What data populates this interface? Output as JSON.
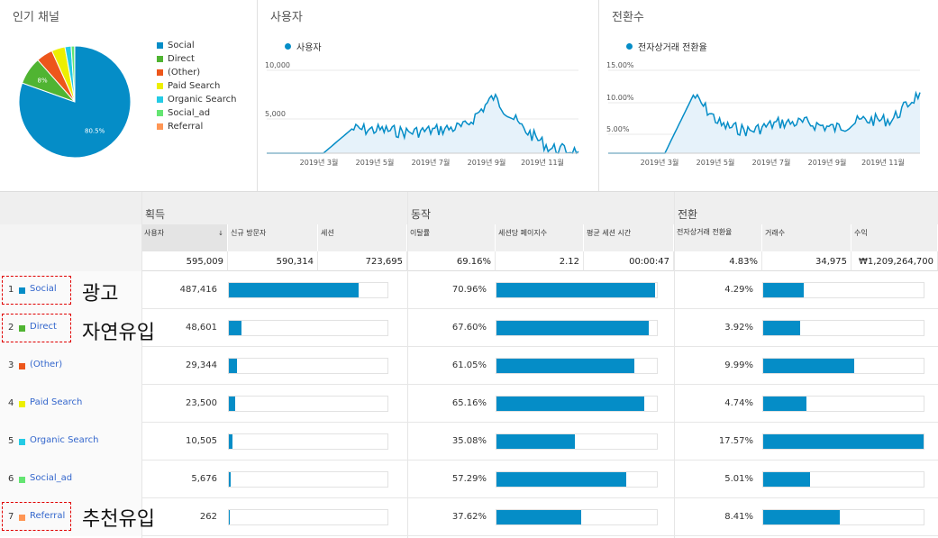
{
  "pie_panel": {
    "title": "인기 채널",
    "slices": [
      {
        "name": "Social",
        "value": 80.5,
        "color": "#058dc7",
        "label": "80.5%"
      },
      {
        "name": "Direct",
        "value": 8.0,
        "color": "#50b432",
        "label": "8%"
      },
      {
        "name": "(Other)",
        "value": 4.8,
        "color": "#ed561b",
        "label": ""
      },
      {
        "name": "Paid Search",
        "value": 3.9,
        "color": "#edef00",
        "label": ""
      },
      {
        "name": "Organic Search",
        "value": 1.8,
        "color": "#24cbe5",
        "label": ""
      },
      {
        "name": "Social_ad",
        "value": 1.0,
        "color": "#64e572",
        "label": ""
      },
      {
        "name": "Referral",
        "value": 0.04,
        "color": "#ff9655",
        "label": ""
      }
    ]
  },
  "chart_data": [
    {
      "type": "area",
      "title": "사용자",
      "series": [
        {
          "name": "사용자",
          "color": "#058dc7"
        }
      ],
      "yticks": [
        "10,000",
        "5,000"
      ],
      "ylim": [
        0,
        11000
      ],
      "xticks": [
        "2019년 3월",
        "2019년 5월",
        "2019년 7월",
        "2019년 9월",
        "2019년 11월"
      ],
      "x": [
        "2019-01",
        "2019-02",
        "2019-03",
        "2019-04",
        "2019-05",
        "2019-06",
        "2019-07",
        "2019-08",
        "2019-09",
        "2019-10",
        "2019-11",
        "2019-12"
      ],
      "values": [
        0,
        0,
        0,
        3000,
        2900,
        2600,
        2900,
        3300,
        7000,
        3200,
        600,
        200
      ]
    },
    {
      "type": "area",
      "title": "전환수",
      "series": [
        {
          "name": "전자상거래 전환율",
          "color": "#058dc7"
        }
      ],
      "yticks": [
        "15.00%",
        "10.00%",
        "5.00%"
      ],
      "ylim": [
        0,
        16
      ],
      "xticks": [
        "2019년 3월",
        "2019년 5월",
        "2019년 7월",
        "2019년 9월",
        "2019년 11월"
      ],
      "x": [
        "2019-01",
        "2019-02",
        "2019-03",
        "2019-04",
        "2019-05",
        "2019-06",
        "2019-07",
        "2019-08",
        "2019-09",
        "2019-10",
        "2019-11",
        "2019-12"
      ],
      "values": [
        0,
        0,
        0,
        10.5,
        5.0,
        4.0,
        5.5,
        5.5,
        4.5,
        6.0,
        6.0,
        11.0
      ]
    }
  ],
  "table": {
    "groups": [
      "획득",
      "동작",
      "전환"
    ],
    "columns": [
      "사용자",
      "신규 방문자",
      "세션",
      "이탈률",
      "세션당 페이지수",
      "평균 세션 시간",
      "전자상거래 전환율",
      "거래수",
      "수익"
    ],
    "sorted_arrow": "↓",
    "totals": [
      "595,009",
      "590,314",
      "723,695",
      "69.16%",
      "2.12",
      "00:00:47",
      "4.83%",
      "34,975",
      "₩1,209,264,700"
    ],
    "rows": [
      {
        "num": "1",
        "channel": "Social",
        "color": "#058dc7",
        "users": "487,416",
        "users_frac": 0.82,
        "bounce": "70.96%",
        "bounce_frac": 0.99,
        "conv": "4.29%",
        "conv_frac": 0.25
      },
      {
        "num": "2",
        "channel": "Direct",
        "color": "#50b432",
        "users": "48,601",
        "users_frac": 0.08,
        "bounce": "67.60%",
        "bounce_frac": 0.95,
        "conv": "3.92%",
        "conv_frac": 0.23
      },
      {
        "num": "3",
        "channel": "(Other)",
        "color": "#ed561b",
        "users": "29,344",
        "users_frac": 0.05,
        "bounce": "61.05%",
        "bounce_frac": 0.86,
        "conv": "9.99%",
        "conv_frac": 0.57
      },
      {
        "num": "4",
        "channel": "Paid Search",
        "color": "#edef00",
        "users": "23,500",
        "users_frac": 0.04,
        "bounce": "65.16%",
        "bounce_frac": 0.92,
        "conv": "4.74%",
        "conv_frac": 0.27
      },
      {
        "num": "5",
        "channel": "Organic Search",
        "color": "#24cbe5",
        "users": "10,505",
        "users_frac": 0.02,
        "bounce": "35.08%",
        "bounce_frac": 0.49,
        "conv": "17.57%",
        "conv_frac": 1.0
      },
      {
        "num": "6",
        "channel": "Social_ad",
        "color": "#64e572",
        "users": "5,676",
        "users_frac": 0.01,
        "bounce": "57.29%",
        "bounce_frac": 0.81,
        "conv": "5.01%",
        "conv_frac": 0.29
      },
      {
        "num": "7",
        "channel": "Referral",
        "color": "#ff9655",
        "users": "262",
        "users_frac": 0.003,
        "bounce": "37.62%",
        "bounce_frac": 0.53,
        "conv": "8.41%",
        "conv_frac": 0.48
      }
    ]
  },
  "annotations": {
    "ad": "광고",
    "organic": "자연유입",
    "referral": "추천유입"
  }
}
